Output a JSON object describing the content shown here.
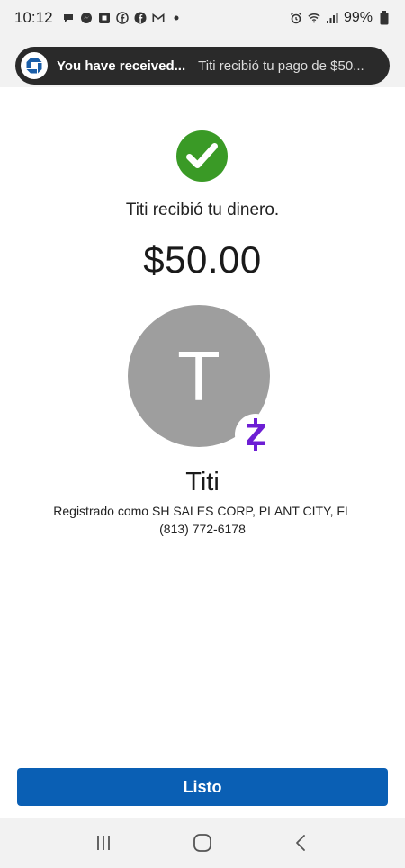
{
  "status_bar": {
    "time": "10:12",
    "battery": "99%",
    "icons": [
      "chat-icon",
      "messenger-icon",
      "chase-icon",
      "facebook-icon",
      "facebook-icon",
      "gmail-icon",
      "dot-icon",
      "alarm-icon",
      "wifi-icon",
      "signal-icon",
      "battery-icon"
    ]
  },
  "notification": {
    "title": "You have received...",
    "body": "Titi recibió tu pago de $50..."
  },
  "confirmation": {
    "message": "Titi recibió tu dinero.",
    "amount": "$50.00"
  },
  "recipient": {
    "initial": "T",
    "name": "Titi",
    "registered": "Registrado como SH SALES CORP, PLANT CITY, FL",
    "phone": "(813) 772-6178"
  },
  "actions": {
    "done_label": "Listo"
  },
  "colors": {
    "success_green": "#3a9a26",
    "zelle_purple": "#6d1ed4",
    "button_blue": "#0a5fb4",
    "avatar_gray": "#9e9e9e"
  },
  "nav": {
    "icons": [
      "recent-apps-icon",
      "home-icon",
      "back-icon"
    ]
  }
}
